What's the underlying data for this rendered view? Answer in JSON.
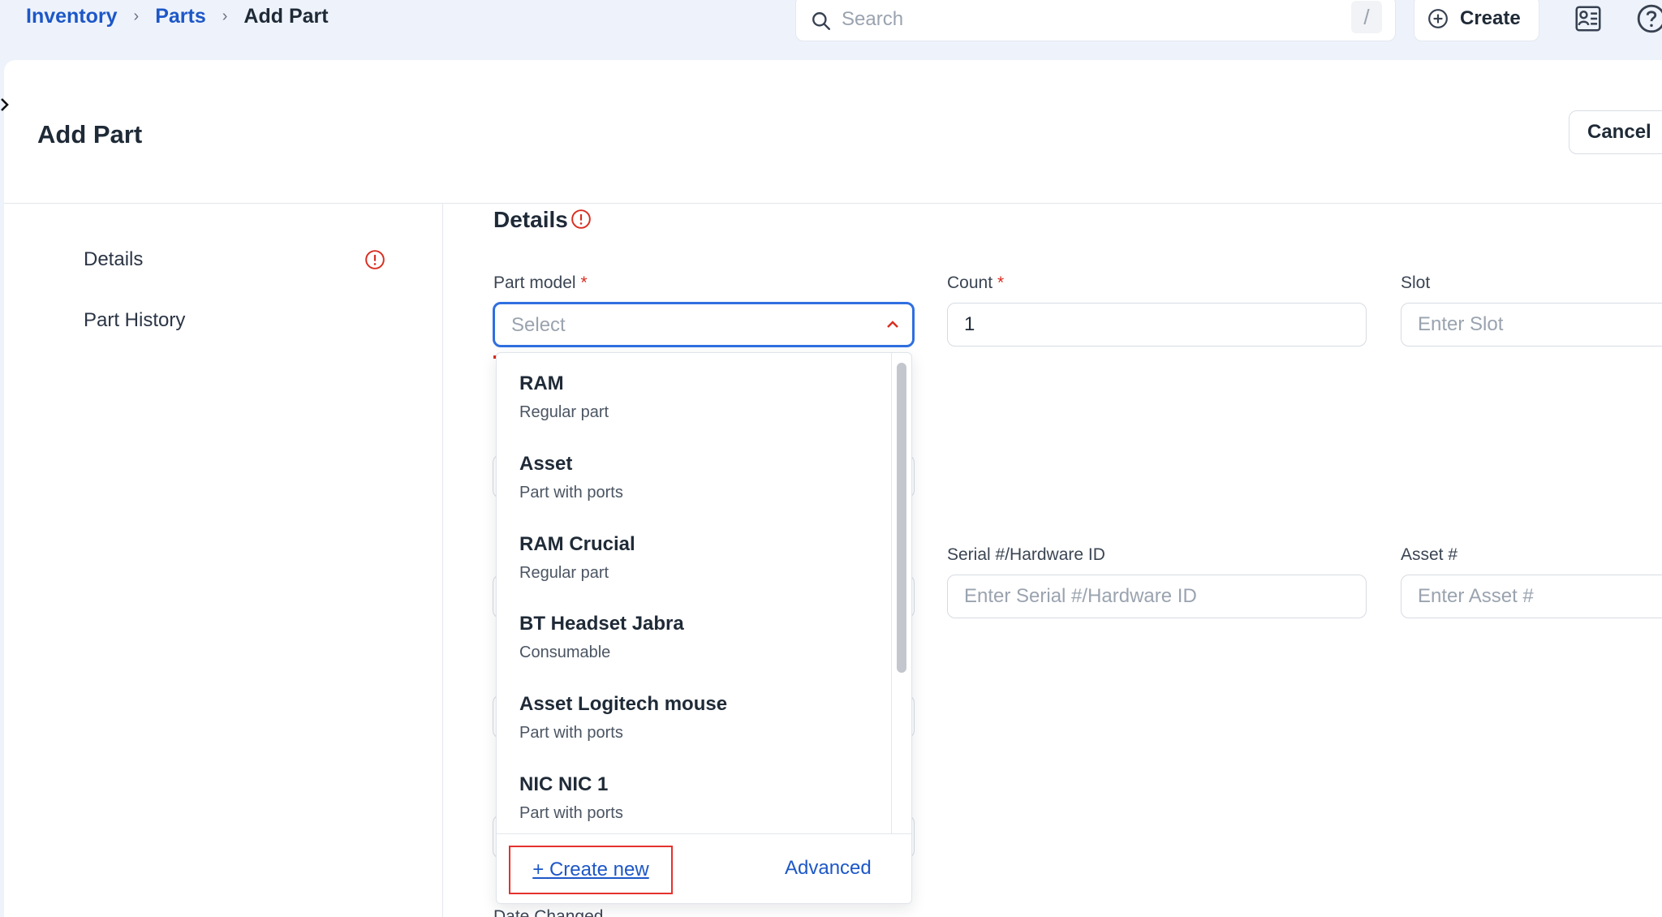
{
  "breadcrumb": {
    "items": [
      "Inventory",
      "Parts"
    ],
    "current": "Add Part"
  },
  "search": {
    "placeholder": "Search",
    "shortcut": "/"
  },
  "header": {
    "create_label": "Create"
  },
  "page": {
    "title": "Add Part",
    "cancel_label": "Cancel"
  },
  "sidebar": {
    "items": [
      {
        "label": "Details",
        "warning": true
      },
      {
        "label": "Part History"
      }
    ]
  },
  "section": {
    "title": "Details"
  },
  "fields": {
    "part_model": {
      "label": "Part model",
      "required": "*",
      "placeholder": "Select"
    },
    "count": {
      "label": "Count",
      "required": "*",
      "value": "1"
    },
    "slot": {
      "label": "Slot",
      "placeholder": "Enter Slot"
    },
    "serial": {
      "label": "Serial #/Hardware ID",
      "placeholder": "Enter Serial #/Hardware ID"
    },
    "asset": {
      "label": "Asset #",
      "placeholder": "Enter Asset #"
    },
    "date_changed": {
      "label": "Date Changed"
    }
  },
  "dropdown": {
    "options": [
      {
        "name": "RAM",
        "type": "Regular part"
      },
      {
        "name": "Asset",
        "type": "Part with ports"
      },
      {
        "name": "RAM Crucial",
        "type": "Regular part"
      },
      {
        "name": "BT Headset Jabra",
        "type": "Consumable"
      },
      {
        "name": "Asset Logitech mouse",
        "type": "Part with ports"
      },
      {
        "name": "NIC NIC 1",
        "type": "Part with ports"
      }
    ],
    "create_new_label": "+ Create new",
    "advanced_label": "Advanced"
  },
  "colors": {
    "accent": "#1d57c7",
    "focus": "#2f6fe0",
    "error": "#d92d20",
    "highlight": "#e5322d"
  }
}
